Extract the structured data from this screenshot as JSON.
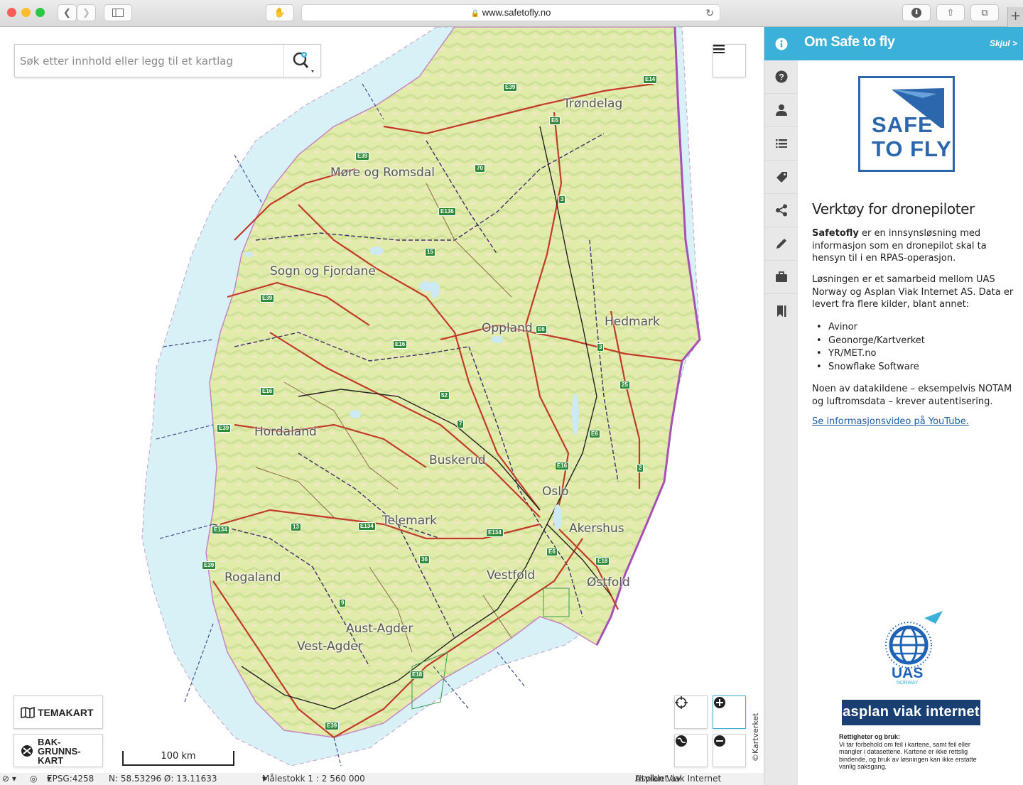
{
  "browser": {
    "url": "www.safetofly.no"
  },
  "map": {
    "search_placeholder": "Søk etter innhold eller legg til et kartlag",
    "labels": {
      "trondelag": "Trøndelag",
      "more": "Møre og Romsdal",
      "sogn": "Sogn og Fjordane",
      "oppland": "Oppland",
      "hedmark": "Hedmark",
      "hordaland": "Hordaland",
      "buskerud": "Buskerud",
      "oslo": "Oslo",
      "telemark": "Telemark",
      "akershus": "Akershus",
      "vestfold": "Vestfold",
      "rogaland": "Rogaland",
      "ostfold": "Østfold",
      "aust_agder": "Aust-Agder",
      "vest_agder": "Vest-Agder"
    },
    "temakart_label": "TEMAKART",
    "bakgrunnskart_label": "BAK-GRUNNS-KART",
    "scale_label": "100 km",
    "copyright": "©Kartverket",
    "road_signs": [
      "E39",
      "E14",
      "E6",
      "E39",
      "70",
      "E136",
      "3",
      "15",
      "E39",
      "E6",
      "E16",
      "3",
      "52",
      "25",
      "E16",
      "E39",
      "7",
      "E6",
      "2",
      "E16",
      "E134",
      "13",
      "E134",
      "E134",
      "E6",
      "36",
      "E18",
      "E39",
      "9",
      "E18",
      "E39"
    ]
  },
  "status": {
    "projection": "EPSG:4258",
    "coords": "N: 58.53296 Ø: 13.11633",
    "scale": "Målestokk 1 : 2 560 000",
    "developed_prefix": "Utviklet av",
    "developed_link": "Asplan Viak Internet"
  },
  "panel": {
    "title": "Om Safe to fly",
    "hide": "Skjul >",
    "logo_line1": "SAFE",
    "logo_line2": "TO FLY",
    "heading": "Verktøy for dronepiloter",
    "p1_bold": "Safetofly",
    "p1_rest": " er en innsynsløsning med informasjon som en dronepilot skal ta hensyn til i en RPAS-operasjon.",
    "p2": "Løsningen er et samarbeid mellom UAS Norway og Asplan Viak Internet AS. Data er levert fra flere kilder, blant annet:",
    "sources": [
      "Avinor",
      "Geonorge/Kartverket",
      "YR/MET.no",
      "Snowflake Software"
    ],
    "p3": "Noen av datakildene – eksempelvis NOTAM og luftromsdata – krever autentisering.",
    "youtube": "Se informasjonsvideo på YouTube.",
    "uas": "UAS",
    "uas_sub": "NORWAY",
    "asplan": "asplan viak internet",
    "rights_title": "Rettigheter og bruk:",
    "rights_text": "Vi tar forbehold om feil i kartene, samt feil eller mangler i datasettene. Kartene er ikke rettslig bindende, og bruk av løsningen kan ikke erstatte vanlig saksgang."
  },
  "colors": {
    "accent": "#3bb0d9",
    "logo_blue": "#2c66ac",
    "asplan_bg": "#1a3f73",
    "land": "#e6eeb0",
    "sea": "#d7f1f6"
  }
}
